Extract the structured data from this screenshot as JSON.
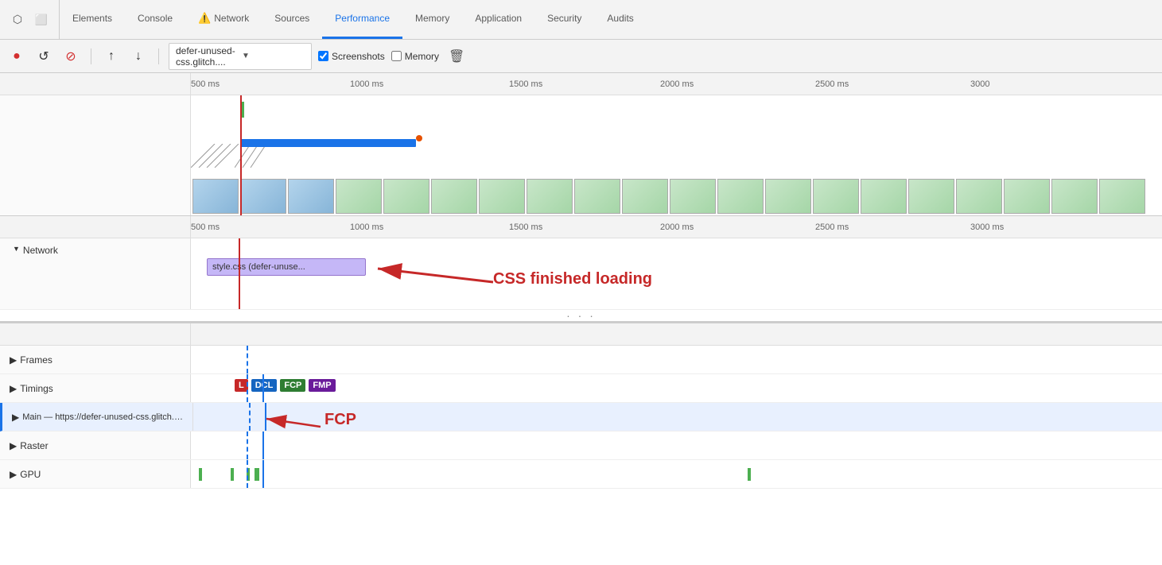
{
  "tabs": {
    "icons": [
      "cursor-icon",
      "device-icon"
    ],
    "items": [
      {
        "label": "Elements",
        "active": false,
        "warn": false
      },
      {
        "label": "Console",
        "active": false,
        "warn": false
      },
      {
        "label": "Network",
        "active": false,
        "warn": true
      },
      {
        "label": "Sources",
        "active": false,
        "warn": false
      },
      {
        "label": "Performance",
        "active": true,
        "warn": false
      },
      {
        "label": "Memory",
        "active": false,
        "warn": false
      },
      {
        "label": "Application",
        "active": false,
        "warn": false
      },
      {
        "label": "Security",
        "active": false,
        "warn": false
      },
      {
        "label": "Audits",
        "active": false,
        "warn": false
      }
    ]
  },
  "toolbar": {
    "record_label": "●",
    "reload_label": "↺",
    "stop_label": "⊘",
    "upload_label": "↑",
    "download_label": "↓",
    "url_value": "defer-unused-css.glitch....",
    "screenshots_label": "Screenshots",
    "memory_label": "Memory",
    "trash_label": "🗑"
  },
  "ruler": {
    "labels_top": [
      "500 ms",
      "1000 ms",
      "1500 ms",
      "2000 ms",
      "2500 ms",
      "3000"
    ],
    "labels_bottom": [
      "500 ms",
      "1000 ms",
      "1500 ms",
      "2000 ms",
      "2500 ms",
      "3000 ms"
    ]
  },
  "network_section": {
    "label": "Network",
    "style_css_bar": "style.css (defer-unuse..."
  },
  "annotations": {
    "css_finished": "CSS finished loading",
    "fcp_label": "FCP"
  },
  "bottom_rows": [
    {
      "label": "Frames",
      "triangle": "▶"
    },
    {
      "label": "Timings",
      "triangle": "▶"
    },
    {
      "label": "Main — https://defer-unused-css.glitch.me/index-optimized.html",
      "triangle": "▶"
    },
    {
      "label": "Raster",
      "triangle": "▶"
    },
    {
      "label": "GPU",
      "triangle": "▶"
    }
  ],
  "timing_badges": [
    {
      "label": "L",
      "class": "badge-l"
    },
    {
      "label": "DCL",
      "class": "badge-dcl"
    },
    {
      "label": "FCP",
      "class": "badge-fcp"
    },
    {
      "label": "FMP",
      "class": "badge-fmp"
    }
  ],
  "colors": {
    "accent_blue": "#1a73e8",
    "red_line": "#c62828",
    "annotation_red": "#c62828"
  }
}
